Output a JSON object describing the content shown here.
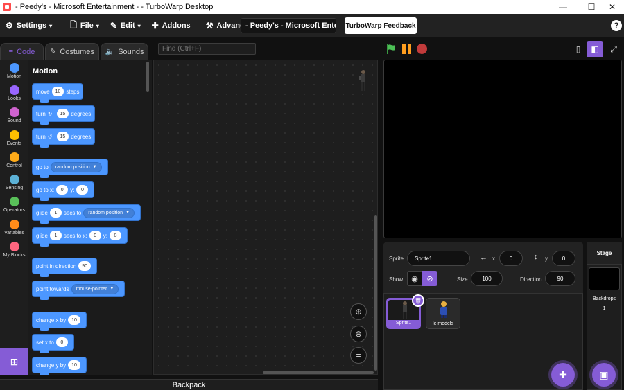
{
  "window": {
    "title": "- Peedy's - Microsoft Entertainment - - TurboWarp Desktop",
    "minimize": "—",
    "maximize": "☐",
    "close": "✕"
  },
  "menubar": {
    "items": [
      {
        "label": "Settings",
        "icon": "gear-icon",
        "glyph": "⚙",
        "caret": "▾"
      },
      {
        "label": "File",
        "icon": "file-icon",
        "glyph": "🗋",
        "caret": "▾"
      },
      {
        "label": "Edit",
        "icon": "pencil-icon",
        "glyph": "✎",
        "caret": "▾"
      },
      {
        "label": "Addons",
        "icon": "puzzle-icon",
        "glyph": "✚",
        "caret": ""
      },
      {
        "label": "Advanced",
        "icon": "wrench-icon",
        "glyph": "⚒",
        "caret": ""
      }
    ],
    "project_title": "- Peedy's - Microsoft Enter...",
    "feedback": "TurboWarp Feedback",
    "help": "?"
  },
  "tabs": {
    "code": "Code",
    "costumes": "Costumes",
    "sounds": "Sounds"
  },
  "find_placeholder": "Find (Ctrl+F)",
  "categories": [
    {
      "label": "Motion",
      "color": "#4c97ff"
    },
    {
      "label": "Looks",
      "color": "#9966ff"
    },
    {
      "label": "Sound",
      "color": "#cf63cf"
    },
    {
      "label": "Events",
      "color": "#ffbf00"
    },
    {
      "label": "Control",
      "color": "#ffab19"
    },
    {
      "label": "Sensing",
      "color": "#5cb1d6"
    },
    {
      "label": "Operators",
      "color": "#59c059"
    },
    {
      "label": "Variables",
      "color": "#ff8c1a"
    },
    {
      "label": "My Blocks",
      "color": "#ff6680"
    }
  ],
  "palette": {
    "title": "Motion",
    "blocks": {
      "move": {
        "t1": "move",
        "v1": "10",
        "t2": "steps"
      },
      "turn_right": {
        "t1": "turn",
        "v1": "15",
        "t2": "degrees"
      },
      "turn_left": {
        "t1": "turn",
        "v1": "15",
        "t2": "degrees"
      },
      "goto": {
        "t1": "go to",
        "d1": "random position"
      },
      "goto_xy": {
        "t1": "go to x:",
        "v1": "0",
        "t2": "y:",
        "v2": "0"
      },
      "glide_to": {
        "t1": "glide",
        "v1": "1",
        "t2": "secs to",
        "d1": "random position"
      },
      "glide_xy": {
        "t1": "glide",
        "v1": "1",
        "t2": "secs to x:",
        "v2": "0",
        "t3": "y:",
        "v3": "0"
      },
      "point_dir": {
        "t1": "point in direction",
        "v1": "90"
      },
      "point_towards": {
        "t1": "point towards",
        "d1": "mouse-pointer"
      },
      "change_x": {
        "t1": "change x by",
        "v1": "10"
      },
      "set_x": {
        "t1": "set x to",
        "v1": "0"
      },
      "change_y": {
        "t1": "change y by",
        "v1": "10"
      }
    }
  },
  "zoom": {
    "in": "⊕",
    "out": "⊖",
    "reset": "="
  },
  "backpack": "Backpack",
  "sprite_info": {
    "sprite_label": "Sprite",
    "sprite_name": "Sprite1",
    "x_label": "x",
    "x_value": "0",
    "y_label": "y",
    "y_value": "0",
    "show_label": "Show",
    "size_label": "Size",
    "size_value": "100",
    "direction_label": "Direction",
    "direction_value": "90"
  },
  "sprites": [
    {
      "name": "Sprite1"
    },
    {
      "name": "le models"
    }
  ],
  "stage_panel": {
    "title": "Stage",
    "backdrops_label": "Backdrops",
    "backdrops_count": "1"
  },
  "colors": {
    "accent": "#855cd6",
    "motion": "#4c97ff",
    "flag": "#4cbf56",
    "pause": "#ff9e1f",
    "stop": "#c23b3b"
  }
}
